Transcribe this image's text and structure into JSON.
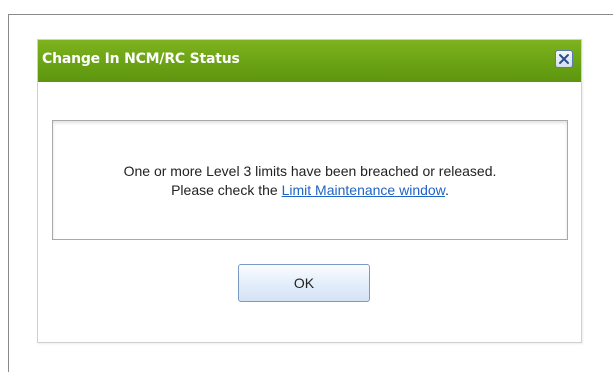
{
  "dialog": {
    "title": "Change In NCM/RC Status",
    "message_line1": "One or more Level 3 limits have been breached or released.",
    "message_line2_prefix": "Please check the ",
    "message_link": "Limit Maintenance window",
    "message_line2_suffix": ".",
    "ok_label": "OK",
    "close_icon": "close-icon"
  },
  "colors": {
    "title_bar": "#6aa314",
    "title_text": "#ffffff",
    "link": "#1f63c7",
    "button_border": "#7a9ac4"
  }
}
